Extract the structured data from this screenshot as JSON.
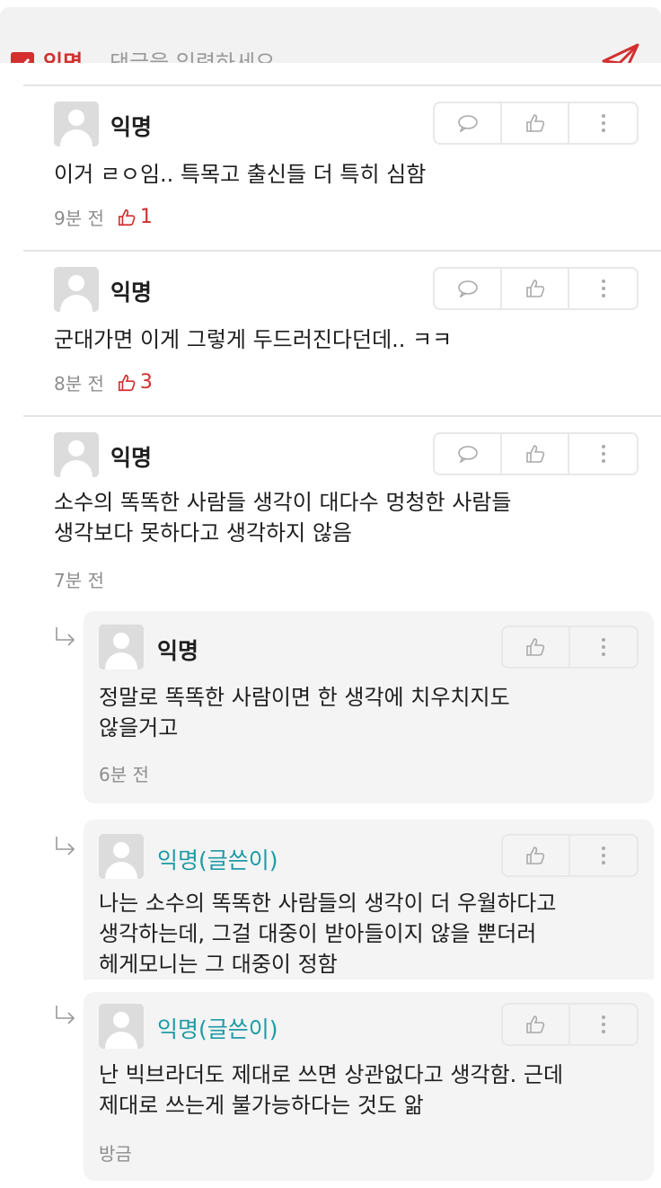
{
  "composer": {
    "anonymous_label": "익명",
    "placeholder": "댓글을 입력하세요."
  },
  "comments": [
    {
      "author": "익명",
      "text": "이거 ㄹㅇ임.. 특목고 출신들 더 특히 심함",
      "time": "9분 전",
      "likes": "1"
    },
    {
      "author": "익명",
      "text": "군대가면 이게 그렇게 두드러진다던데.. ㅋㅋ",
      "time": "8분 전",
      "likes": "3"
    },
    {
      "author": "익명",
      "text_line1": "소수의 똑똑한 사람들 생각이 대다수 멍청한 사람들",
      "text_line2": "생각보다 못하다고 생각하지 않음",
      "time": "7분 전"
    }
  ],
  "replies": [
    {
      "author": "익명",
      "text_line1": "정말로 똑똑한 사람이면 한 생각에 치우치지도",
      "text_line2": "않을거고",
      "time": "6분 전"
    },
    {
      "author": "익명(글쓴이)",
      "text_line1": "나는 소수의 똑똑한 사람들의 생각이 더 우월하다고",
      "text_line2": "생각하는데, 그걸 대중이 받아들이지 않을 뿐더러",
      "text_line3": "헤게모니는 그 대중이 정함"
    },
    {
      "author": "익명(글쓴이)",
      "text_line1": "난 빅브라더도 제대로 쓰면 상관없다고 생각함. 근데",
      "text_line2": "제대로 쓰는게 불가능하다는 것도 앎",
      "time": "방금"
    }
  ],
  "icons": {
    "checkbox": "checkbox-checked-icon",
    "send": "send-icon",
    "comment": "speech-bubble-icon",
    "like": "thumbs-up-icon",
    "more": "more-vertical-icon",
    "reply": "reply-arrow-icon"
  },
  "colors": {
    "accent_red": "#d32f2f",
    "op_teal": "#1e9aa5",
    "muted": "#8d8d8d",
    "reply_bg": "#f4f4f4"
  }
}
